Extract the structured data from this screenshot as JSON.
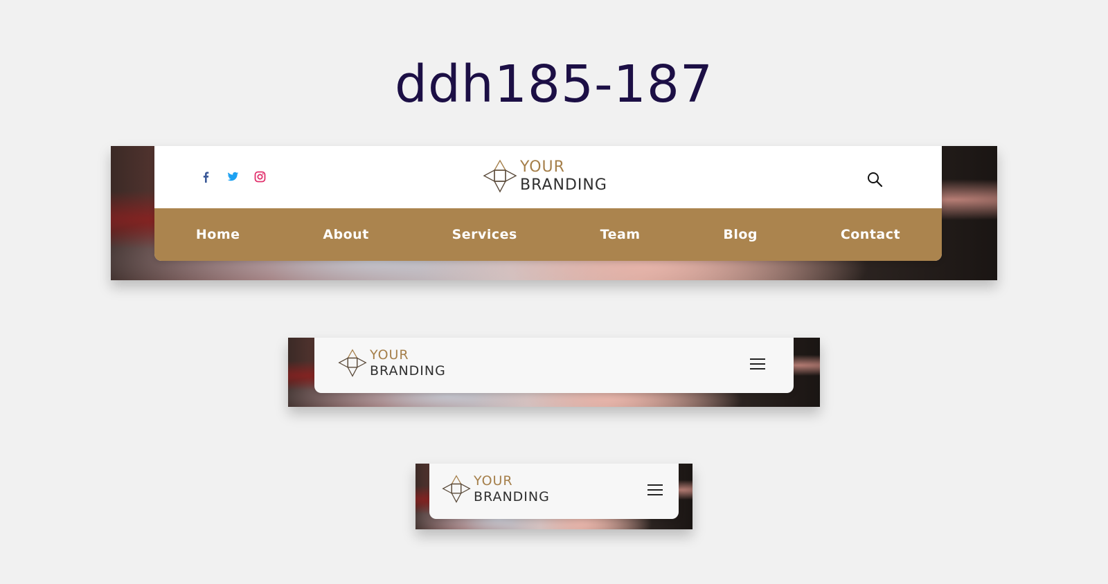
{
  "page": {
    "title": "ddh185-187"
  },
  "desktop_header": {
    "social": [
      {
        "name": "facebook-icon",
        "color": "#3b5998"
      },
      {
        "name": "twitter-icon",
        "color": "#1da1f2"
      },
      {
        "name": "instagram-icon",
        "color": "#e1306c"
      }
    ],
    "logo": {
      "line1": "YOUR",
      "line2": "BRANDING"
    },
    "search_icon": "search-icon",
    "nav": [
      {
        "label": "Home"
      },
      {
        "label": "About"
      },
      {
        "label": "Services"
      },
      {
        "label": "Team"
      },
      {
        "label": "Blog"
      },
      {
        "label": "Contact"
      }
    ],
    "accent_color": "#ab844e"
  },
  "tablet_header": {
    "logo": {
      "line1": "YOUR",
      "line2": "BRANDING"
    },
    "menu_icon": "hamburger-menu-icon"
  },
  "mobile_header": {
    "logo": {
      "line1": "YOUR",
      "line2": "BRANDING"
    },
    "menu_icon": "hamburger-menu-icon"
  }
}
